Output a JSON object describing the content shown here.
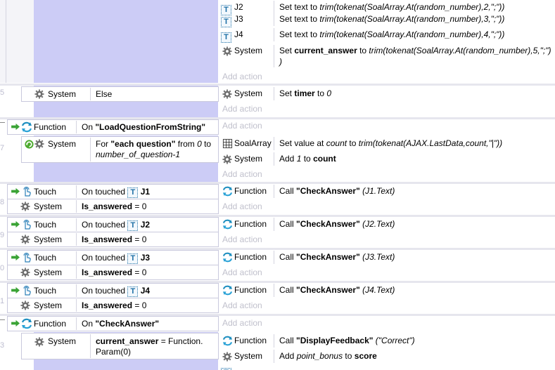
{
  "gutter": [
    "5",
    "7",
    "8",
    "9",
    "0",
    "1",
    "3"
  ],
  "top_actions": [
    {
      "obj": "J2",
      "pre": "Set text to ",
      "expr": "trim(tokenat(SoalArray.At(random_number),2,\";\"))"
    },
    {
      "obj": "J3",
      "pre": "Set text to ",
      "expr": "trim(tokenat(SoalArray.At(random_number),3,\";\"))"
    },
    {
      "obj": "J4",
      "pre": "Set text to ",
      "expr": "trim(tokenat(SoalArray.At(random_number),4,\";\"))"
    }
  ],
  "system_set": {
    "obj": "System",
    "pre": "Set ",
    "var": "current_answer",
    "mid": " to ",
    "expr1": "trim(tokenat(SoalArray.At(random_number),5,\";\")",
    "expr2": ")"
  },
  "add_action": "Add action",
  "else_event": {
    "obj": "System",
    "cond": "Else",
    "act_obj": "System",
    "act_pre": "Set ",
    "act_var": "timer",
    "act_mid": " to ",
    "act_val": "0"
  },
  "fn_load": {
    "obj": "Function",
    "pre": "On ",
    "name": "\"LoadQuestionFromString\""
  },
  "loop_event": {
    "obj": "System",
    "line1_pre": "For ",
    "line1_name": "\"each question\"",
    "line1_mid": " from ",
    "line1_val": "0",
    "line1_post": " to",
    "line2": "number_of_question-1",
    "act1_obj": "SoalArray",
    "act1_pre": "Set value at ",
    "act1_expr": "count",
    "act1_mid": " to ",
    "act1_expr2": "trim(tokenat(AJAX.LastData,count,\"|\"))",
    "act2_obj": "System",
    "act2_pre": "Add ",
    "act2_val": "1",
    "act2_mid": " to ",
    "act2_var": "count"
  },
  "touch_events": [
    {
      "obj": "Touch",
      "pre": "On touched ",
      "target": "J1",
      "sys": "System",
      "cond_var": "Is_answered",
      "cond_post": " = 0",
      "act_obj": "Function",
      "act_pre": "Call ",
      "act_name": "\"CheckAnswer\"",
      "act_param": " (J1.Text)"
    },
    {
      "obj": "Touch",
      "pre": "On touched ",
      "target": "J2",
      "sys": "System",
      "cond_var": "Is_answered",
      "cond_post": " = 0",
      "act_obj": "Function",
      "act_pre": "Call ",
      "act_name": "\"CheckAnswer\"",
      "act_param": " (J2.Text)"
    },
    {
      "obj": "Touch",
      "pre": "On touched ",
      "target": "J3",
      "sys": "System",
      "cond_var": "Is_answered",
      "cond_post": " = 0",
      "act_obj": "Function",
      "act_pre": "Call ",
      "act_name": "\"CheckAnswer\"",
      "act_param": " (J3.Text)"
    },
    {
      "obj": "Touch",
      "pre": "On touched ",
      "target": "J4",
      "sys": "System",
      "cond_var": "Is_answered",
      "cond_post": " = 0",
      "act_obj": "Function",
      "act_pre": "Call ",
      "act_name": "\"CheckAnswer\"",
      "act_param": " (J4.Text)"
    }
  ],
  "fn_check": {
    "obj": "Function",
    "pre": "On ",
    "name": "\"CheckAnswer\""
  },
  "check_event": {
    "obj": "System",
    "cond_var": "current_answer",
    "cond_post": " = Function.",
    "cond_line2": "Param(0)",
    "act1_obj": "Function",
    "act1_pre": "Call ",
    "act1_name": "\"DisplayFeedback\"",
    "act1_param": " (\"Correct\")",
    "act2_obj": "System",
    "act2_pre": "Add ",
    "act2_var1": "point_bonus",
    "act2_mid": " to ",
    "act2_var2": "score"
  },
  "colors": {
    "lavender": "#ccccf6",
    "separator": "#e6e6ee",
    "add_action": "#c0c0cc",
    "t_icon": "#1d6fa5",
    "function_icon": "#1e8fc0",
    "arrow_green": "#3aa335"
  }
}
